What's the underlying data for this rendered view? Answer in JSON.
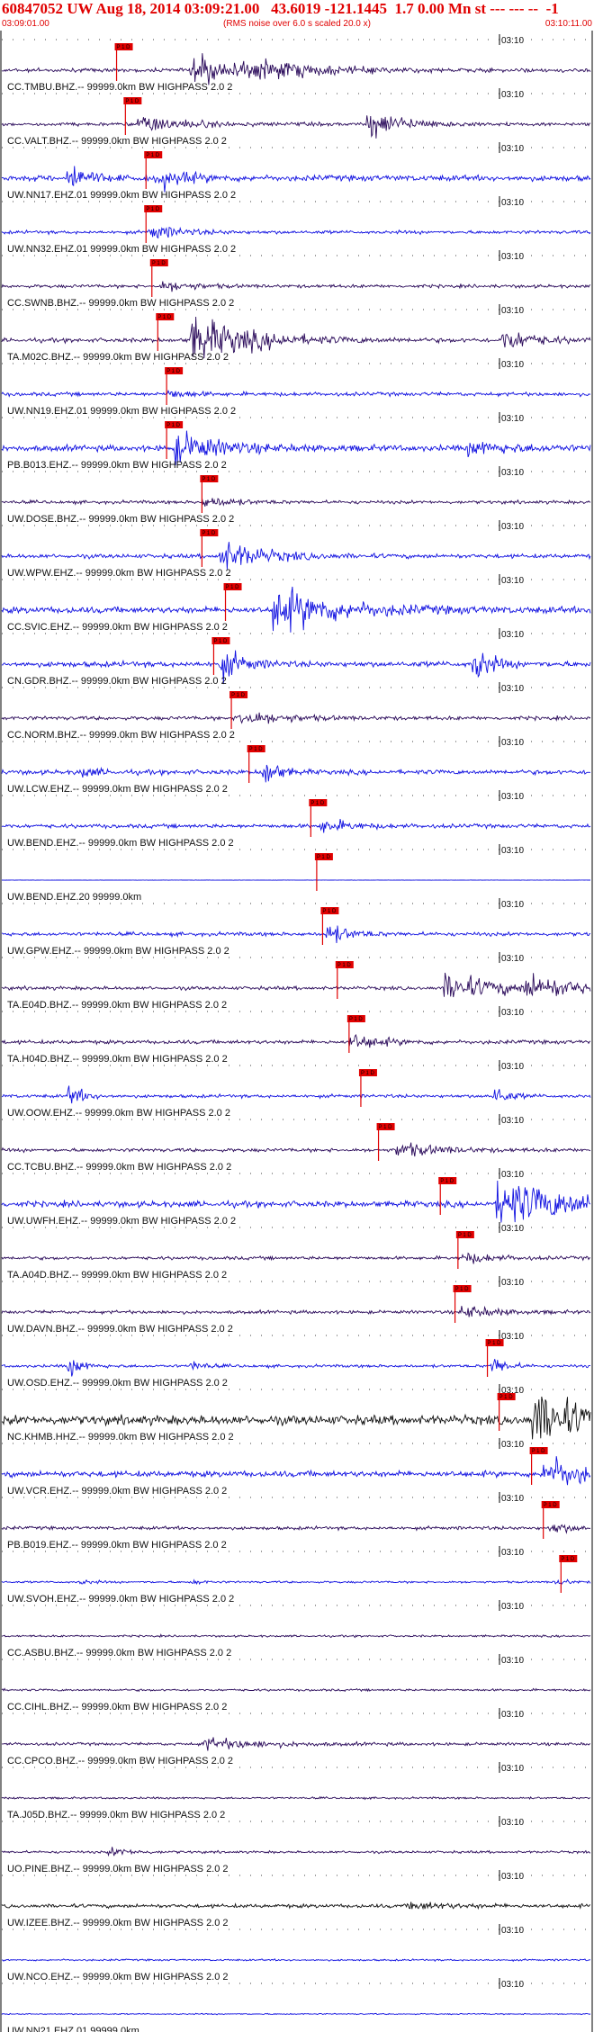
{
  "header": {
    "title": "60847052 UW Aug 18, 2014 03:09:21.00   43.6019 -121.1445  1.7 0.00 Mn st --- --- --  -1",
    "start_time": "03:09:01.00",
    "end_time": "03:10:11.00",
    "note": "(RMS noise over 6.0 s scaled 20.0 x)"
  },
  "chart_data": {
    "type": "seismogram",
    "time_mark_label": "03:10",
    "pick_label": "P 1 D",
    "colors": {
      "header": "#e00000",
      "pick": "#e00000",
      "navy": "#2a0a5a",
      "blue": "#1010e0",
      "black": "#101010"
    },
    "traces": [
      {
        "label": "CC.TMBU.BHZ.-- 99999.0km BW  HIGHPASS  2.0  2",
        "color": "navy",
        "amp": 0.16,
        "pick": 0.195,
        "events": [
          [
            0.33,
            7.0,
            0.12
          ],
          [
            0.44,
            3.0,
            0.06
          ]
        ]
      },
      {
        "label": "CC.VALT.BHZ.-- 99999.0km BW  HIGHPASS  2.0  2",
        "color": "navy",
        "amp": 0.14,
        "pick": 0.21,
        "events": [
          [
            0.24,
            5.0,
            0.05
          ],
          [
            0.63,
            8.0,
            0.03
          ]
        ]
      },
      {
        "label": "UW.NN17.EHZ.01 99999.0km BW  HIGHPASS  2.0  2",
        "color": "blue",
        "amp": 0.25,
        "pick": 0.245,
        "events": [
          [
            0.12,
            5.0,
            0.006
          ],
          [
            0.27,
            3.0,
            0.02
          ]
        ]
      },
      {
        "label": "UW.NN32.EHZ.01 99999.0km BW  HIGHPASS  2.0  2",
        "color": "blue",
        "amp": 0.14,
        "pick": 0.245,
        "events": [
          [
            0.26,
            4.0,
            0.02
          ]
        ]
      },
      {
        "label": "CC.SWNB.BHZ.-- 99999.0km BW  HIGHPASS  2.0  2",
        "color": "navy",
        "amp": 0.14,
        "pick": 0.255,
        "events": [
          [
            0.28,
            3.0,
            0.02
          ]
        ]
      },
      {
        "label": "TA.M02C.BHZ.-- 99999.0km BW  HIGHPASS  2.0  2",
        "color": "navy",
        "amp": 0.18,
        "pick": 0.265,
        "events": [
          [
            0.33,
            11.0,
            0.08
          ],
          [
            0.86,
            5.0,
            0.02
          ]
        ]
      },
      {
        "label": "UW.NN19.EHZ.01 99999.0km BW  HIGHPASS  2.0  2",
        "color": "blue",
        "amp": 0.16,
        "pick": 0.28,
        "events": [
          [
            0.29,
            2.0,
            0.01
          ]
        ]
      },
      {
        "label": "PB.B013.EHZ.-- 99999.0km BW  HIGHPASS  2.0  2",
        "color": "blue",
        "amp": 0.26,
        "pick": 0.28,
        "events": [
          [
            0.3,
            5.0,
            0.05
          ],
          [
            0.8,
            2.0,
            0.05
          ]
        ]
      },
      {
        "label": "UW.DOSE.BHZ.-- 99999.0km BW  HIGHPASS  2.0  2",
        "color": "navy",
        "amp": 0.14,
        "pick": 0.34,
        "events": [
          [
            0.35,
            3.0,
            0.02
          ]
        ]
      },
      {
        "label": "UW.WPW.EHZ.-- 99999.0km BW  HIGHPASS  2.0  2",
        "color": "blue",
        "amp": 0.18,
        "pick": 0.34,
        "events": [
          [
            0.38,
            7.0,
            0.04
          ]
        ]
      },
      {
        "label": "CC.SVIC.EHZ.-- 99999.0km BW  HIGHPASS  2.0  2",
        "color": "blue",
        "amp": 0.28,
        "pick": 0.38,
        "events": [
          [
            0.47,
            7.0,
            0.09
          ]
        ]
      },
      {
        "label": "CN.GDR.BHZ.-- 99999.0km BW  HIGHPASS  2.0  2",
        "color": "blue",
        "amp": 0.24,
        "pick": 0.36,
        "events": [
          [
            0.38,
            5.0,
            0.01
          ],
          [
            0.81,
            6.0,
            0.005
          ]
        ]
      },
      {
        "label": "CC.NORM.BHZ.-- 99999.0km BW  HIGHPASS  2.0  2",
        "color": "navy",
        "amp": 0.16,
        "pick": 0.39,
        "events": [
          [
            0.41,
            4.0,
            0.04
          ]
        ]
      },
      {
        "label": "UW.LCW.EHZ.-- 99999.0km BW  HIGHPASS  2.0  2",
        "color": "blue",
        "amp": 0.2,
        "pick": 0.42,
        "events": [
          [
            0.14,
            2.0,
            0.005
          ],
          [
            0.45,
            6.0,
            0.004
          ]
        ]
      },
      {
        "label": "UW.BEND.EHZ.-- 99999.0km BW  HIGHPASS  2.0  2",
        "color": "blue",
        "amp": 0.17,
        "pick": 0.525,
        "events": [
          [
            0.55,
            3.0,
            0.02
          ]
        ]
      },
      {
        "label": "UW.BEND.EHZ.20 99999.0km",
        "color": "blue",
        "amp": 0.0,
        "pick": 0.535,
        "events": []
      },
      {
        "label": "UW.GPW.EHZ.-- 99999.0km BW  HIGHPASS  2.0  2",
        "color": "blue",
        "amp": 0.16,
        "pick": 0.545,
        "events": [
          [
            0.56,
            5.0,
            0.01
          ]
        ]
      },
      {
        "label": "TA.E04D.BHZ.-- 99999.0km BW  HIGHPASS  2.0  2",
        "color": "navy",
        "amp": 0.15,
        "pick": 0.57,
        "events": [
          [
            0.76,
            8.0,
            0.07
          ],
          [
            0.9,
            6.0,
            0.06
          ]
        ]
      },
      {
        "label": "TA.H04D.BHZ.-- 99999.0km BW  HIGHPASS  2.0  2",
        "color": "navy",
        "amp": 0.16,
        "pick": 0.59,
        "events": [
          [
            0.6,
            4.0,
            0.02
          ]
        ]
      },
      {
        "label": "UW.OOW.EHZ.-- 99999.0km BW  HIGHPASS  2.0  2",
        "color": "blue",
        "amp": 0.14,
        "pick": 0.61,
        "events": [
          [
            0.12,
            6.0,
            0.004
          ],
          [
            0.84,
            6.0,
            0.004
          ]
        ]
      },
      {
        "label": "CC.TCBU.BHZ.-- 99999.0km BW  HIGHPASS  2.0  2",
        "color": "navy",
        "amp": 0.15,
        "pick": 0.64,
        "events": [
          [
            0.68,
            4.0,
            0.04
          ]
        ]
      },
      {
        "label": "UW.UWFH.EHZ.-- 99999.0km BW  HIGHPASS  2.0  2",
        "color": "blue",
        "amp": 0.26,
        "pick": 0.745,
        "events": [
          [
            0.85,
            8.0,
            0.15
          ]
        ]
      },
      {
        "label": "TA.A04D.BHZ.-- 99999.0km BW  HIGHPASS  2.0  2",
        "color": "navy",
        "amp": 0.14,
        "pick": 0.775,
        "events": [
          [
            0.79,
            3.0,
            0.02
          ]
        ]
      },
      {
        "label": "UW.DAVN.BHZ.-- 99999.0km BW  HIGHPASS  2.0  2",
        "color": "navy",
        "amp": 0.14,
        "pick": 0.77,
        "events": [
          [
            0.79,
            4.0,
            0.02
          ]
        ]
      },
      {
        "label": "UW.OSD.EHZ.-- 99999.0km BW  HIGHPASS  2.0  2",
        "color": "blue",
        "amp": 0.12,
        "pick": 0.825,
        "events": [
          [
            0.12,
            6.0,
            0.004
          ],
          [
            0.33,
            3.0,
            0.003
          ],
          [
            0.84,
            6.0,
            0.004
          ]
        ]
      },
      {
        "label": "NC.KHMB.HHZ.-- 99999.0km BW  HIGHPASS  2.0  2",
        "color": "black",
        "amp": 0.42,
        "pick": 0.845,
        "events": [
          [
            0.91,
            6.0,
            0.06
          ]
        ]
      },
      {
        "label": "UW.VCR.EHZ.-- 99999.0km BW  HIGHPASS  2.0  2",
        "color": "blue",
        "amp": 0.26,
        "pick": 0.9,
        "events": [
          [
            0.93,
            6.0,
            0.03
          ]
        ]
      },
      {
        "label": "PB.B019.EHZ.-- 99999.0km BW  HIGHPASS  2.0  2",
        "color": "navy",
        "amp": 0.14,
        "pick": 0.92,
        "events": [
          [
            0.94,
            3.0,
            0.01
          ]
        ]
      },
      {
        "label": "UW.SVOH.EHZ.-- 99999.0km BW  HIGHPASS  2.0  2",
        "color": "blue",
        "amp": 0.08,
        "pick": 0.95,
        "events": [
          [
            0.14,
            2.0,
            0.003
          ],
          [
            0.33,
            2.0,
            0.003
          ],
          [
            0.95,
            3.0,
            0.003
          ]
        ]
      },
      {
        "label": "CC.ASBU.BHZ.-- 99999.0km BW  HIGHPASS  2.0  2",
        "color": "navy",
        "amp": 0.08,
        "events": []
      },
      {
        "label": "CC.CIHL.BHZ.-- 99999.0km BW  HIGHPASS  2.0  2",
        "color": "navy",
        "amp": 0.09,
        "events": []
      },
      {
        "label": "CC.CPCO.BHZ.-- 99999.0km BW  HIGHPASS  2.0  2",
        "color": "navy",
        "amp": 0.12,
        "events": [
          [
            0.35,
            4.0,
            0.08
          ]
        ]
      },
      {
        "label": "TA.J05D.BHZ.-- 99999.0km BW  HIGHPASS  2.0  2",
        "color": "navy",
        "amp": 0.08,
        "events": []
      },
      {
        "label": "UO.PINE.BHZ.-- 99999.0km BW  HIGHPASS  2.0  2",
        "color": "navy",
        "amp": 0.1,
        "events": [
          [
            0.19,
            3.0,
            0.01
          ]
        ]
      },
      {
        "label": "UW.IZEE.BHZ.-- 99999.0km BW  HIGHPASS  2.0  2",
        "color": "black",
        "amp": 0.16,
        "events": [
          [
            0.7,
            2.0,
            0.03
          ]
        ]
      },
      {
        "label": "UW.NCO.EHZ.-- 99999.0km BW  HIGHPASS  2.0  2",
        "color": "blue",
        "amp": 0.07,
        "events": []
      },
      {
        "label": "UW.NN21.EHZ.01 99999.0km",
        "color": "blue",
        "amp": 0.04,
        "events": []
      }
    ]
  }
}
